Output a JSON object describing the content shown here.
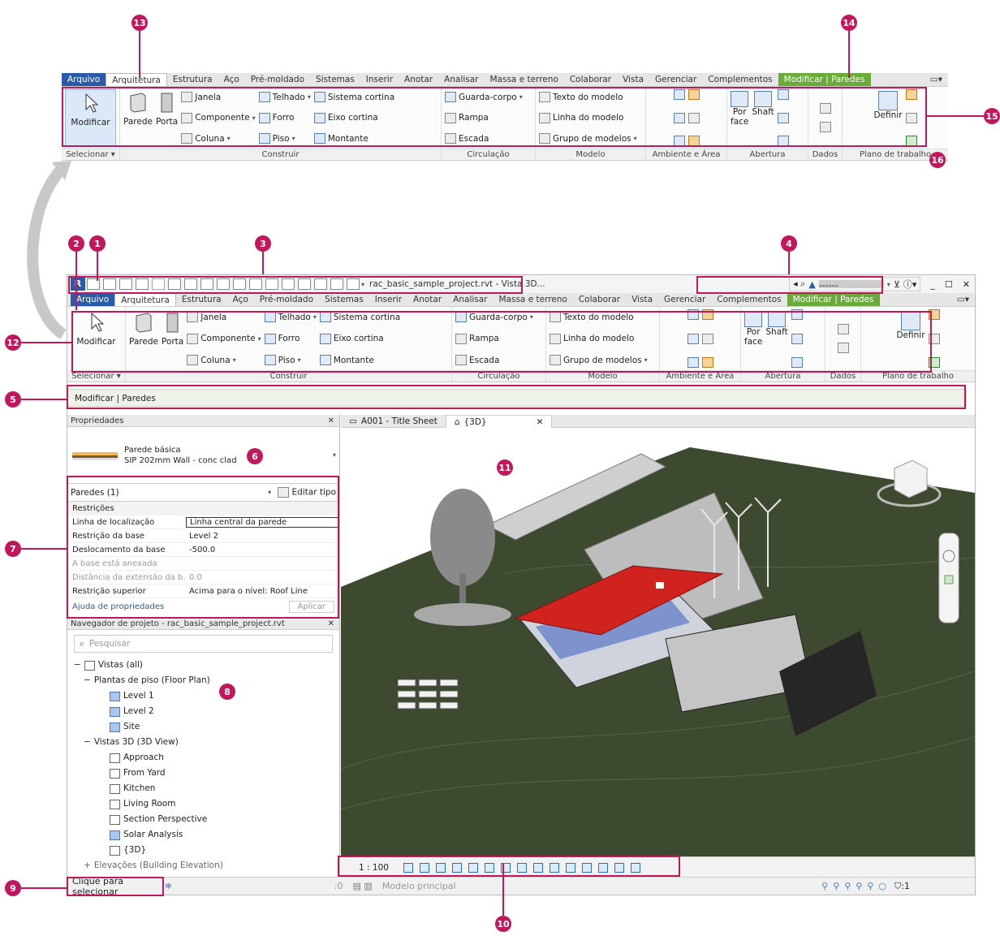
{
  "callouts": [
    "1",
    "2",
    "3",
    "4",
    "5",
    "6",
    "7",
    "8",
    "9",
    "10",
    "11",
    "12",
    "13",
    "14",
    "15",
    "16"
  ],
  "colors": {
    "accent": "#c2185b",
    "file_tab": "#2a5aa8",
    "context_tab": "#6aaa3a",
    "roof": "#d0231f",
    "terrain": "#3e4a2f"
  },
  "ribbon": {
    "tabs": [
      "Arquivo",
      "Arquitetura",
      "Estrutura",
      "Aço",
      "Pré-moldado",
      "Sistemas",
      "Inserir",
      "Anotar",
      "Analisar",
      "Massa e terreno",
      "Colaborar",
      "Vista",
      "Gerenciar",
      "Complementos",
      "Modificar | Paredes"
    ],
    "select": {
      "button": "Modificar",
      "title": "Selecionar ▾"
    },
    "build": {
      "title": "Construir",
      "parede": "Parede",
      "porta": "Porta",
      "janela": "Janela",
      "componente": "Componente",
      "coluna": "Coluna",
      "telhado": "Telhado",
      "forro": "Forro",
      "piso": "Piso",
      "sistema_cortina": "Sistema cortina",
      "eixo_cortina": "Eixo cortina",
      "montante": "Montante"
    },
    "circulation": {
      "title": "Circulação",
      "guarda_corpo": "Guarda-corpo",
      "rampa": "Rampa",
      "escada": "Escada"
    },
    "model": {
      "title": "Modelo",
      "texto": "Texto do modelo",
      "linha": "Linha do modelo",
      "grupo": "Grupo de modelos"
    },
    "room_area": {
      "title": "Ambiente e Área"
    },
    "opening": {
      "title": "Abertura",
      "por_face": "Por\nface",
      "shaft": "Shaft"
    },
    "datum": {
      "title": "Dados"
    },
    "work_plane": {
      "title": "Plano de trabalho",
      "definir": "Definir"
    }
  },
  "app": {
    "title": "rac_basic_sample_project.rvt - Vista 3D...",
    "user": "------",
    "options_bar": "Modificar | Paredes",
    "properties": {
      "title": "Propriedades",
      "type_name": "Parede básica",
      "type_sub": "SIP 202mm Wall - conc clad",
      "filter": "Paredes (1)",
      "edit_type": "Editar tipo",
      "section": "Restrições",
      "rows": [
        {
          "k": "Linha de localização",
          "v": "Linha central da parede",
          "dim": false
        },
        {
          "k": "Restrição da base",
          "v": "Level 2",
          "dim": false
        },
        {
          "k": "Deslocamento da base",
          "v": "-500.0",
          "dim": false
        },
        {
          "k": "A base está anexada",
          "v": "",
          "dim": true
        },
        {
          "k": "Distância da extensão da b...",
          "v": "0.0",
          "dim": true
        },
        {
          "k": "Restrição superior",
          "v": "Acima para o nível: Roof Line",
          "dim": false
        }
      ],
      "help": "Ajuda de propriedades",
      "apply": "Aplicar"
    },
    "browser": {
      "title": "Navegador de projeto - rac_basic_sample_project.rvt",
      "search_placeholder": "Pesquisar",
      "root": "Vistas (all)",
      "floor_group": "Plantas de piso (Floor Plan)",
      "floor": [
        "Level 1",
        "Level 2",
        "Site"
      ],
      "view3d_group": "Vistas 3D (3D View)",
      "views3d": [
        "Approach",
        "From Yard",
        "Kitchen",
        "Living Room",
        "Section Perspective",
        "Solar Analysis",
        "{3D}"
      ],
      "elevations": "Elevações (Building Elevation)"
    },
    "view_tabs": [
      {
        "label": "A001 - Title Sheet"
      },
      {
        "label": "{3D}"
      }
    ],
    "scale": "1 : 100",
    "status": "Clique para selecionar",
    "status_model": "Modelo principal",
    "status_zero": ":0",
    "filter_count": ":1"
  }
}
